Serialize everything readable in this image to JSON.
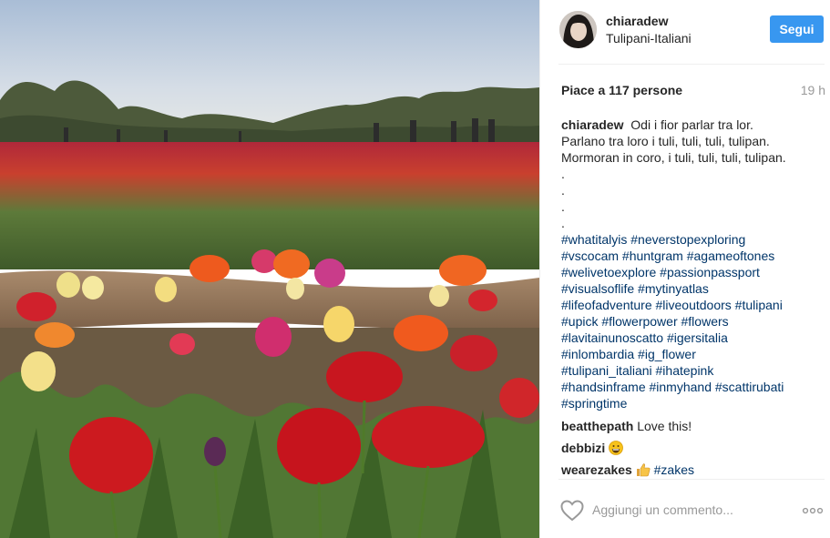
{
  "post": {
    "author": "chiaradew",
    "location": "Tulipani-Italiani",
    "follow_label": "Segui",
    "likes": "Piace a 117 persone",
    "time": "19 h"
  },
  "caption": {
    "author": "chiaradew",
    "lines": [
      "Odi i fior parlar tra lor.",
      "Parlano tra loro i tuli, tuli, tuli, tulipan.",
      "Mormoran in coro, i tuli, tuli, tuli, tulipan."
    ],
    "dots": [
      ".",
      ".",
      ".",
      "."
    ],
    "hashtag_lines": [
      "#whatitalyis #neverstopexploring",
      "#vscocam #huntgram #agameoftones",
      "#welivetoexplore #passionpassport",
      "#visualsoflife #mytinyatlas",
      "#lifeofadventure #liveoutdoors #tulipani",
      "#upick #flowerpower #flowers",
      "#lavitainunoscatto #igersitalia",
      "#inlombardia #ig_flower",
      "#tulipani_italiani #ihatepink",
      "#handsinframe #inmyhand #scattirubati",
      "#springtime"
    ]
  },
  "comments": [
    {
      "user": "beatthepath",
      "text": "Love this!"
    },
    {
      "user": "debbizi",
      "emoji": "grinning-face-emoji"
    },
    {
      "user": "wearezakes",
      "emoji": "thumbs-up-emoji",
      "tag": "#zakes"
    }
  ],
  "footer": {
    "comment_placeholder": "Aggiungi un commento...",
    "like_icon": "heart-outline-icon",
    "more_icon": "more-options-icon"
  },
  "colors": {
    "follow_button": "#3897f0",
    "hashtag": "#003569",
    "muted_text": "#999999"
  }
}
